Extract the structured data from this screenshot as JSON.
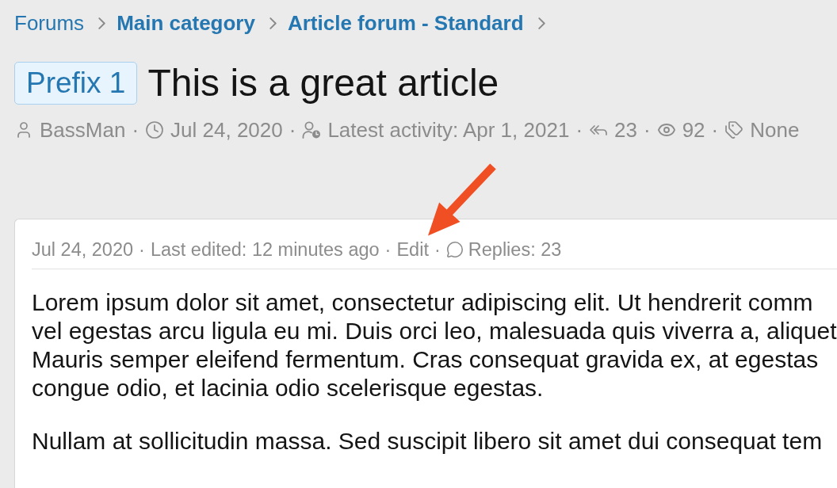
{
  "breadcrumb": [
    {
      "label": "Forums",
      "kind": "root"
    },
    {
      "label": "Main category",
      "kind": "node"
    },
    {
      "label": "Article forum - Standard",
      "kind": "node"
    }
  ],
  "thread": {
    "prefix": "Prefix 1",
    "title": "This is a great article",
    "meta": [
      {
        "kind": "author",
        "text": "BassMan"
      },
      {
        "kind": "separator",
        "text": "·"
      },
      {
        "kind": "start_date",
        "text": "Jul 24, 2020"
      },
      {
        "kind": "separator",
        "text": "·"
      },
      {
        "kind": "latest_activity",
        "text": "Latest activity: Apr 1, 2021"
      },
      {
        "kind": "separator",
        "text": "·"
      },
      {
        "kind": "replies",
        "text": "23"
      },
      {
        "kind": "separator",
        "text": "·"
      },
      {
        "kind": "views",
        "text": "92"
      },
      {
        "kind": "separator",
        "text": "·"
      },
      {
        "kind": "tags",
        "text": "None"
      }
    ]
  },
  "post": {
    "meta": [
      {
        "kind": "date",
        "text": "Jul 24, 2020"
      },
      {
        "kind": "separator",
        "text": "·"
      },
      {
        "kind": "edited",
        "text": "Last edited: 12 minutes ago"
      },
      {
        "kind": "separator",
        "text": "·"
      },
      {
        "kind": "edit",
        "text": "Edit"
      },
      {
        "kind": "separator",
        "text": "·"
      },
      {
        "kind": "replies",
        "text": "Replies: 23"
      }
    ],
    "paragraphs": [
      {
        "lines": [
          "Lorem ipsum dolor sit amet, consectetur adipiscing elit. Ut hendrerit comm",
          "vel egestas arcu ligula eu mi. Duis orci leo, malesuada quis viverra a, aliquet",
          "Mauris semper eleifend fermentum. Cras consequat gravida ex, at egestas",
          "congue odio, et lacinia odio scelerisque egestas."
        ]
      },
      {
        "lines": [
          "Nullam at sollicitudin massa. Sed suscipit libero sit amet dui consequat tem"
        ]
      }
    ]
  }
}
